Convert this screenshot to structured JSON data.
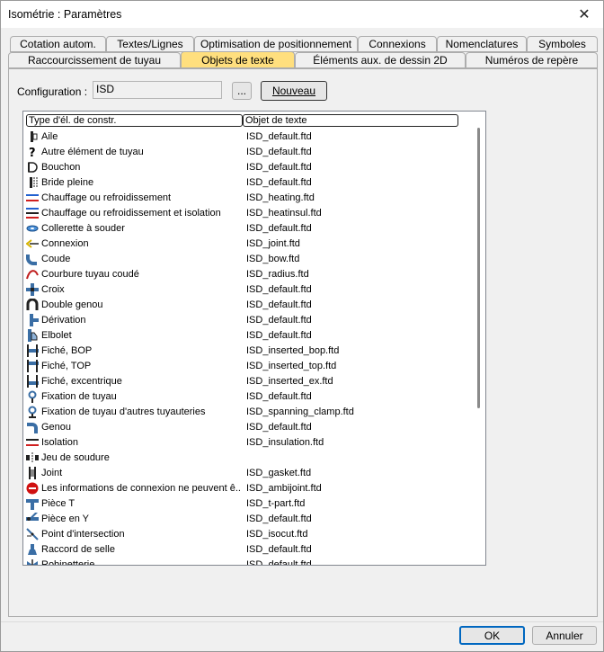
{
  "window": {
    "title": "Isométrie : Paramètres"
  },
  "tabs_row1": [
    {
      "label": "Cotation autom."
    },
    {
      "label": "Textes/Lignes"
    },
    {
      "label": "Optimisation de positionnement"
    },
    {
      "label": "Connexions"
    },
    {
      "label": "Nomenclatures"
    },
    {
      "label": "Symboles"
    }
  ],
  "tabs_row2": [
    {
      "label": "Raccourcissement de tuyau"
    },
    {
      "label": "Objets de texte"
    },
    {
      "label": "Éléments aux. de dessin 2D"
    },
    {
      "label": "Numéros de repère"
    }
  ],
  "active_tab": "Objets de texte",
  "config": {
    "label": "Configuration :",
    "value": "ISD",
    "browse_label": "...",
    "new_label": "Nouveau"
  },
  "list": {
    "headers": [
      "Type d'él. de constr.",
      "Objet de texte"
    ],
    "rows": [
      {
        "name": "Aile",
        "file": "ISD_default.ftd",
        "icon": "flange-icon"
      },
      {
        "name": "Autre élément de tuyau",
        "file": "ISD_default.ftd",
        "icon": "question-icon"
      },
      {
        "name": "Bouchon",
        "file": "ISD_default.ftd",
        "icon": "cap-icon"
      },
      {
        "name": "Bride pleine",
        "file": "ISD_default.ftd",
        "icon": "blind-flange-icon"
      },
      {
        "name": "Chauffage ou refroidissement",
        "file": "ISD_heating.ftd",
        "icon": "heating-icon"
      },
      {
        "name": "Chauffage ou refroidissement et isolation",
        "file": "ISD_heatinsul.ftd",
        "icon": "heating-insulation-icon"
      },
      {
        "name": "Collerette à souder",
        "file": "ISD_default.ftd",
        "icon": "weld-collar-icon"
      },
      {
        "name": "Connexion",
        "file": "ISD_joint.ftd",
        "icon": "connection-icon"
      },
      {
        "name": "Coude",
        "file": "ISD_bow.ftd",
        "icon": "elbow-icon"
      },
      {
        "name": "Courbure tuyau coudé",
        "file": "ISD_radius.ftd",
        "icon": "bend-icon"
      },
      {
        "name": "Croix",
        "file": "ISD_default.ftd",
        "icon": "cross-icon"
      },
      {
        "name": "Double genou",
        "file": "ISD_default.ftd",
        "icon": "double-elbow-icon"
      },
      {
        "name": "Dérivation",
        "file": "ISD_default.ftd",
        "icon": "branch-icon"
      },
      {
        "name": "Elbolet",
        "file": "ISD_default.ftd",
        "icon": "elbolet-icon"
      },
      {
        "name": "Fiché, BOP",
        "file": "ISD_inserted_bop.ftd",
        "icon": "inserted-bop-icon"
      },
      {
        "name": "Fiché, TOP",
        "file": "ISD_inserted_top.ftd",
        "icon": "inserted-top-icon"
      },
      {
        "name": "Fiché, excentrique",
        "file": "ISD_inserted_ex.ftd",
        "icon": "inserted-eccentric-icon"
      },
      {
        "name": "Fixation de tuyau",
        "file": "ISD_default.ftd",
        "icon": "pipe-clamp-icon"
      },
      {
        "name": "Fixation de tuyau d'autres tuyauteries",
        "file": "ISD_spanning_clamp.ftd",
        "icon": "spanning-clamp-icon"
      },
      {
        "name": "Genou",
        "file": "ISD_default.ftd",
        "icon": "knee-icon"
      },
      {
        "name": "Isolation",
        "file": "ISD_insulation.ftd",
        "icon": "insulation-icon"
      },
      {
        "name": "Jeu de soudure",
        "file": "",
        "icon": "weld-gap-icon"
      },
      {
        "name": "Joint",
        "file": "ISD_gasket.ftd",
        "icon": "gasket-icon"
      },
      {
        "name": "Les informations de connexion ne peuvent ê...",
        "file": "ISD_ambijoint.ftd",
        "icon": "no-entry-icon"
      },
      {
        "name": "Pièce T",
        "file": "ISD_t-part.ftd",
        "icon": "tee-icon"
      },
      {
        "name": "Pièce en Y",
        "file": "ISD_default.ftd",
        "icon": "wye-icon"
      },
      {
        "name": "Point d'intersection",
        "file": "ISD_isocut.ftd",
        "icon": "intersection-icon"
      },
      {
        "name": "Raccord de selle",
        "file": "ISD_default.ftd",
        "icon": "saddle-icon"
      },
      {
        "name": "Robinetterie",
        "file": "ISD_default.ftd",
        "icon": "valve-icon"
      }
    ]
  },
  "footer": {
    "ok_label": "OK",
    "cancel_label": "Annuler"
  },
  "colors": {
    "active_tab": "#ffdf7e",
    "window_bg": "#f0f0f0",
    "list_bg": "#ffffff"
  }
}
